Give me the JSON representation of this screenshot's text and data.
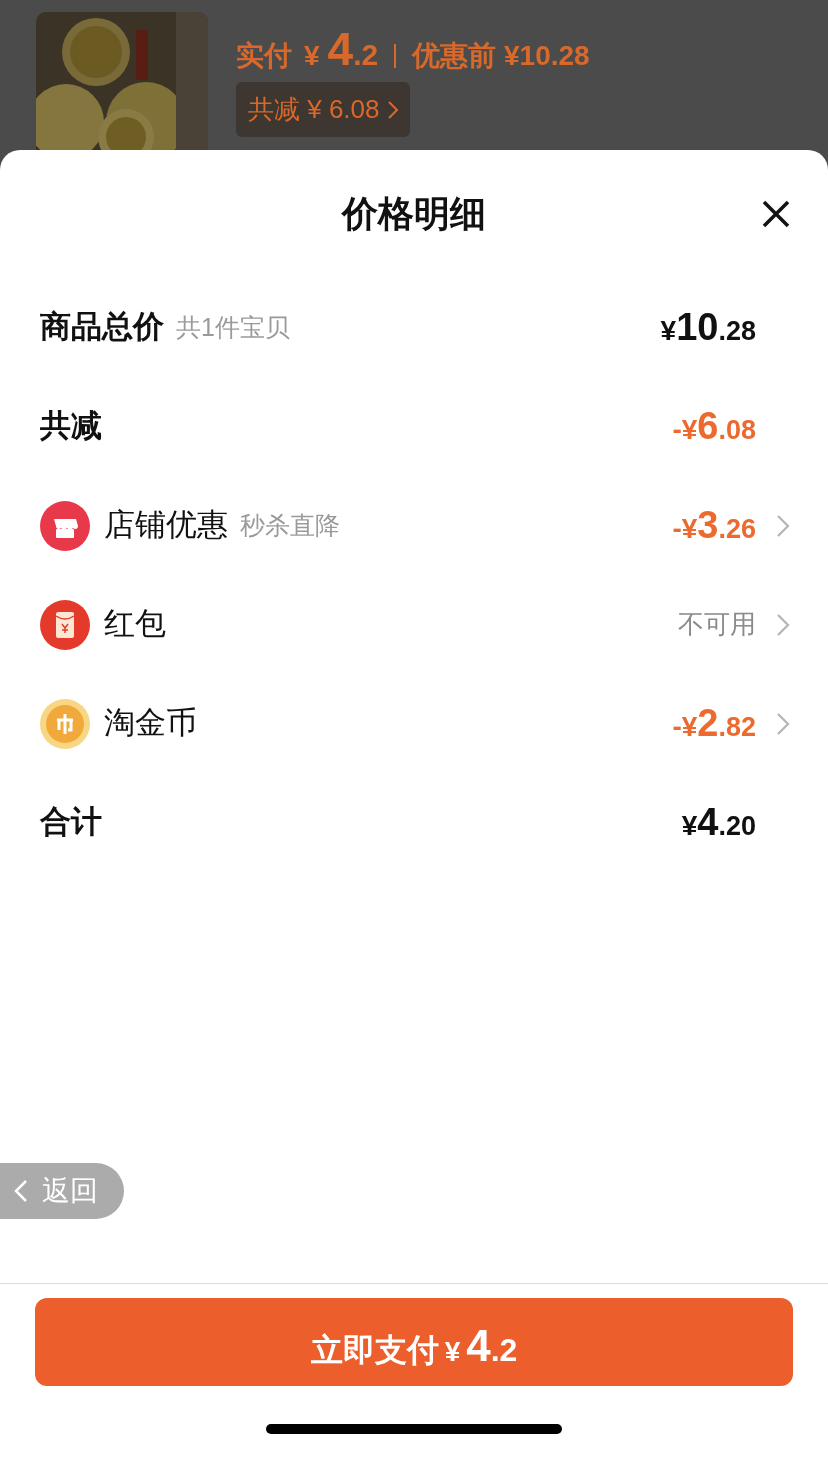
{
  "background_page": {
    "paid_label": "实付",
    "paid_price": {
      "currency": "¥",
      "integer": "4",
      "decimal": ".2"
    },
    "original_price": "优惠前 ¥10.28",
    "discount_tag": "共减 ¥ 6.08"
  },
  "sheet": {
    "title": "价格明细",
    "rows": [
      {
        "kind": "summary",
        "label": "商品总价",
        "note": "共1件宝贝",
        "value": {
          "currency": "¥",
          "integer": "10",
          "decimal": ".28"
        },
        "highlighted": false,
        "chevron": false
      },
      {
        "kind": "summary",
        "label": "共减",
        "value": {
          "currency": "-¥",
          "integer": "6",
          "decimal": ".08"
        },
        "highlighted": true,
        "chevron": false
      },
      {
        "kind": "store",
        "label": "店铺优惠",
        "note": "秒杀直降",
        "value": {
          "currency": "-¥",
          "integer": "3",
          "decimal": ".26"
        },
        "highlighted": true,
        "chevron": true
      },
      {
        "kind": "envelope",
        "label": "红包",
        "status": "不可用",
        "chevron": true
      },
      {
        "kind": "coin",
        "label": "淘金币",
        "value": {
          "currency": "-¥",
          "integer": "2",
          "decimal": ".82"
        },
        "highlighted": true,
        "chevron": true
      },
      {
        "kind": "summary",
        "label": "合计",
        "value": {
          "currency": "¥",
          "integer": "4",
          "decimal": ".20"
        },
        "highlighted": false,
        "chevron": false
      }
    ],
    "back_button": "返回",
    "pay_button": {
      "label": "立即支付",
      "price": {
        "currency": "¥",
        "integer": "4",
        "decimal": ".2"
      }
    }
  }
}
